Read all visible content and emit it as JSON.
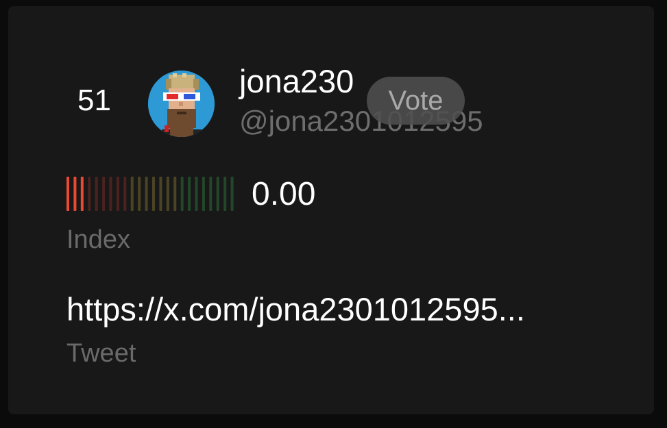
{
  "entry": {
    "rank": "51",
    "username": "jona230",
    "handle": "@jona2301012595",
    "vote_label": "Vote",
    "avatar_icon": "pixel-avatar-3d-glasses",
    "index": {
      "value": "0.00",
      "label": "Index",
      "bar_count": 24,
      "active_bars": 3,
      "colors": {
        "active": "#e84b32",
        "inactive_red": "#4a2320",
        "inactive_yellow": "#4b4424",
        "inactive_green": "#23472a"
      }
    },
    "tweet": {
      "url_display": "https://x.com/jona2301012595...",
      "label": "Tweet"
    }
  }
}
